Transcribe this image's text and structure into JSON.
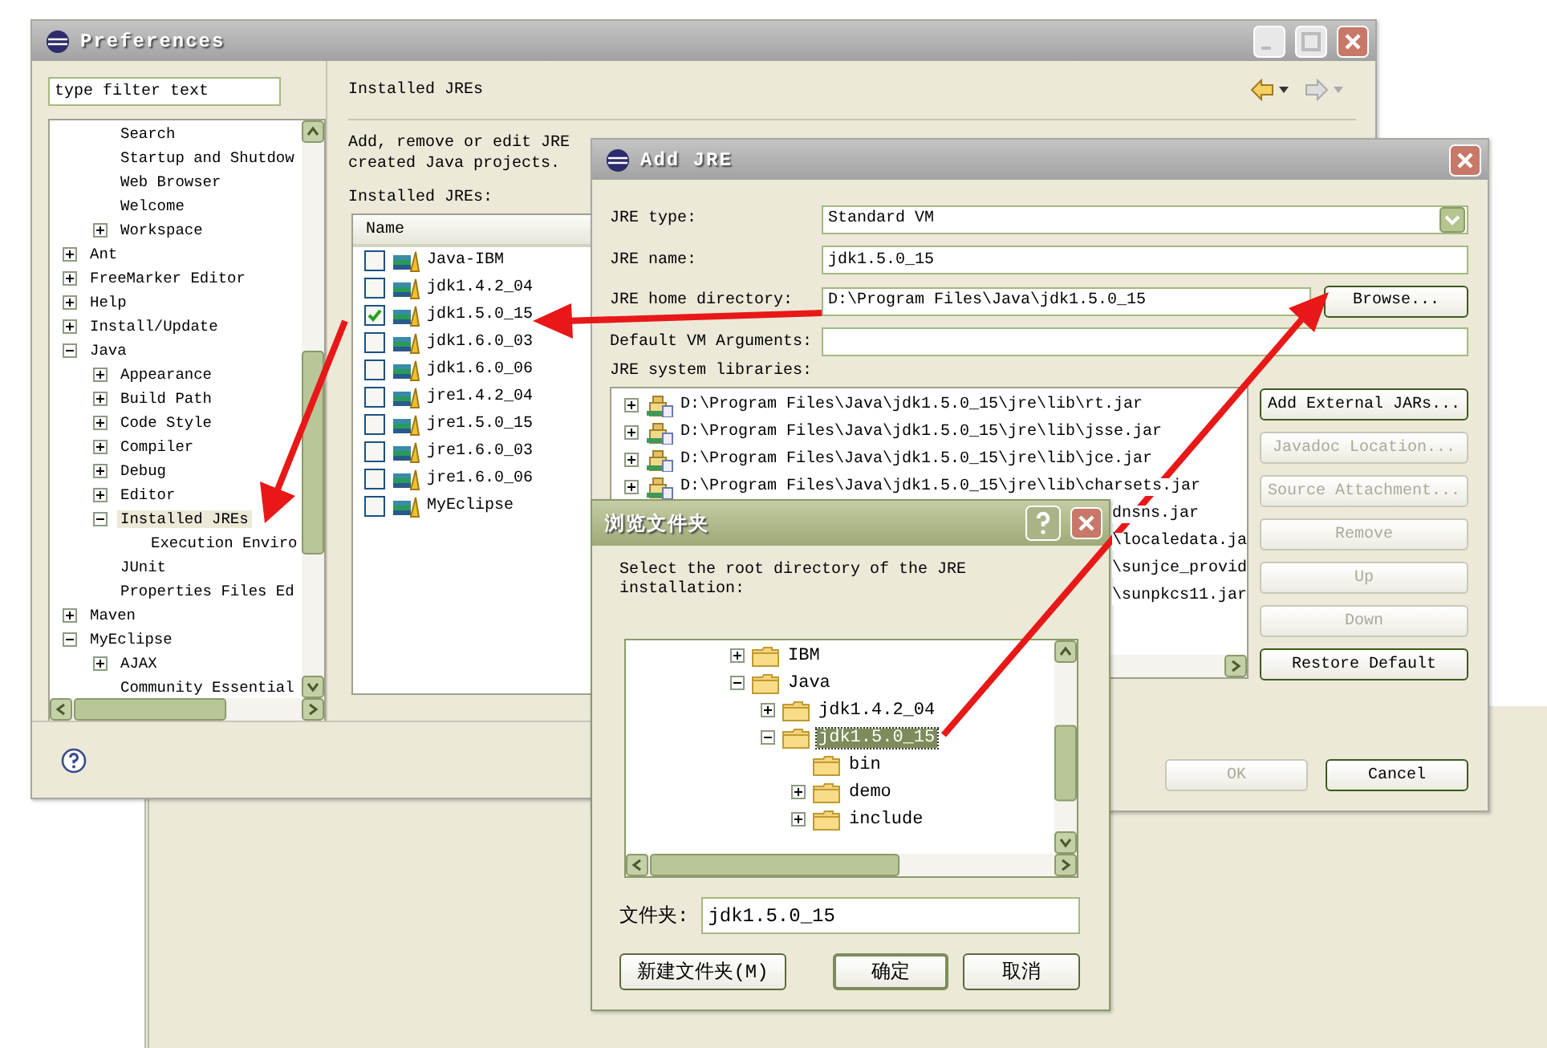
{
  "preferences": {
    "title": "Preferences",
    "filter": {
      "placeholder": "type filter text"
    },
    "tree": [
      {
        "children": [
          {
            "label": "Search",
            "selected": false
          },
          {
            "label": "Startup and Shutdow",
            "selected": false
          },
          {
            "label": "Web Browser",
            "selected": false
          },
          {
            "label": "Welcome",
            "selected": false
          },
          {
            "label": "Workspace",
            "expanded": false,
            "selected": false
          }
        ]
      },
      {
        "label": "Ant",
        "expanded": false,
        "selected": false
      },
      {
        "label": "FreeMarker Editor",
        "expanded": false,
        "selected": false
      },
      {
        "label": "Help",
        "expanded": false,
        "selected": false
      },
      {
        "label": "Install/Update",
        "expanded": false,
        "selected": false
      },
      {
        "label": "Java",
        "expanded": true,
        "selected": false,
        "children": [
          {
            "label": "Appearance",
            "expanded": false,
            "selected": false
          },
          {
            "label": "Build Path",
            "expanded": false,
            "selected": false
          },
          {
            "label": "Code Style",
            "expanded": false,
            "selected": false
          },
          {
            "label": "Compiler",
            "expanded": false,
            "selected": false
          },
          {
            "label": "Debug",
            "expanded": false,
            "selected": false
          },
          {
            "label": "Editor",
            "expanded": false,
            "selected": false
          },
          {
            "label": "Installed JREs",
            "expanded": true,
            "selected": true,
            "children": [
              {
                "label": "Execution Enviro",
                "selected": false
              }
            ]
          },
          {
            "label": "JUnit",
            "selected": false
          },
          {
            "label": "Properties Files Ed",
            "selected": false
          }
        ]
      },
      {
        "label": "Maven",
        "expanded": false,
        "selected": false
      },
      {
        "label": "MyEclipse",
        "expanded": true,
        "selected": false,
        "children": [
          {
            "label": "AJAX",
            "expanded": false,
            "selected": false
          },
          {
            "label": "Community Essential",
            "selected": false
          }
        ]
      }
    ],
    "page_title": "Installed JREs",
    "description": [
      "Add, remove or edit JRE",
      "created Java projects."
    ],
    "list_label": "Installed JREs:",
    "table": {
      "columns": [
        "Name"
      ],
      "rows": [
        {
          "name": "Java-IBM",
          "checked": false
        },
        {
          "name": "jdk1.4.2_04",
          "checked": false
        },
        {
          "name": "jdk1.5.0_15",
          "checked": true
        },
        {
          "name": "jdk1.6.0_03",
          "checked": false
        },
        {
          "name": "jdk1.6.0_06",
          "checked": false
        },
        {
          "name": "jre1.4.2_04",
          "checked": false
        },
        {
          "name": "jre1.5.0_15",
          "checked": false
        },
        {
          "name": "jre1.6.0_03",
          "checked": false
        },
        {
          "name": "jre1.6.0_06",
          "checked": false
        },
        {
          "name": "MyEclipse",
          "checked": false
        }
      ]
    }
  },
  "add_jre": {
    "title": "Add JRE",
    "fields": [
      {
        "label": "JRE type:",
        "kind": "dropdown",
        "value": "Standard VM"
      },
      {
        "label": "JRE name:",
        "kind": "text",
        "value": "jdk1.5.0_15"
      },
      {
        "label": "JRE home directory:",
        "kind": "browse",
        "value": "D:\\Program Files\\Java\\jdk1.5.0_15",
        "button": "Browse..."
      },
      {
        "label": "Default VM Arguments:",
        "kind": "text"
      }
    ],
    "libraries": {
      "label": "JRE system libraries:",
      "items": [
        {
          "kind": "full",
          "path": "D:\\Program Files\\Java\\jdk1.5.0_15\\jre\\lib\\rt.jar"
        },
        {
          "kind": "full",
          "path": "D:\\Program Files\\Java\\jdk1.5.0_15\\jre\\lib\\jsse.jar"
        },
        {
          "kind": "full",
          "path": "D:\\Program Files\\Java\\jdk1.5.0_15\\jre\\lib\\jce.jar"
        },
        {
          "kind": "full",
          "path": "D:\\Program Files\\Java\\jdk1.5.0_15\\jre\\lib\\charsets.jar"
        },
        {
          "kind": "partial",
          "path": "dnsns.jar"
        },
        {
          "kind": "partial",
          "path": "\\localedata.ja"
        },
        {
          "kind": "partial",
          "path": "\\sunjce_provid"
        },
        {
          "kind": "partial",
          "path": "\\sunpkcs11.jar"
        }
      ]
    },
    "side_buttons": [
      {
        "label": "Add External JARs...",
        "disabled": false
      },
      {
        "label": "Javadoc Location...",
        "disabled": true
      },
      {
        "label": "Source Attachment...",
        "disabled": true
      },
      {
        "label": "Remove",
        "disabled": true
      },
      {
        "label": "Up",
        "disabled": true
      },
      {
        "label": "Down",
        "disabled": true
      },
      {
        "label": "Restore Default",
        "disabled": false
      }
    ],
    "buttons": [
      {
        "label": "OK",
        "disabled": true
      },
      {
        "label": "Cancel",
        "disabled": false
      }
    ]
  },
  "browse_dialog": {
    "title": "浏览文件夹",
    "instruction": "Select the root directory of the JRE installation:",
    "tree": [
      {
        "label": "IBM",
        "expanded": false,
        "selected": false
      },
      {
        "label": "Java",
        "expanded": true,
        "selected": false,
        "children": [
          {
            "label": "jdk1.4.2_04",
            "expanded": false,
            "selected": false
          },
          {
            "label": "jdk1.5.0_15",
            "expanded": true,
            "selected": true,
            "children": [
              {
                "label": "bin",
                "selected": false
              },
              {
                "label": "demo",
                "expanded": false,
                "selected": false
              },
              {
                "label": "include",
                "expanded": false,
                "selected": false
              }
            ]
          }
        ]
      }
    ],
    "folder_label": "文件夹:",
    "folder_value": "jdk1.5.0_15",
    "buttons": [
      {
        "label": "新建文件夹(M)",
        "default": false
      },
      {
        "label": "确定",
        "default": true
      },
      {
        "label": "取消",
        "default": false
      }
    ]
  }
}
